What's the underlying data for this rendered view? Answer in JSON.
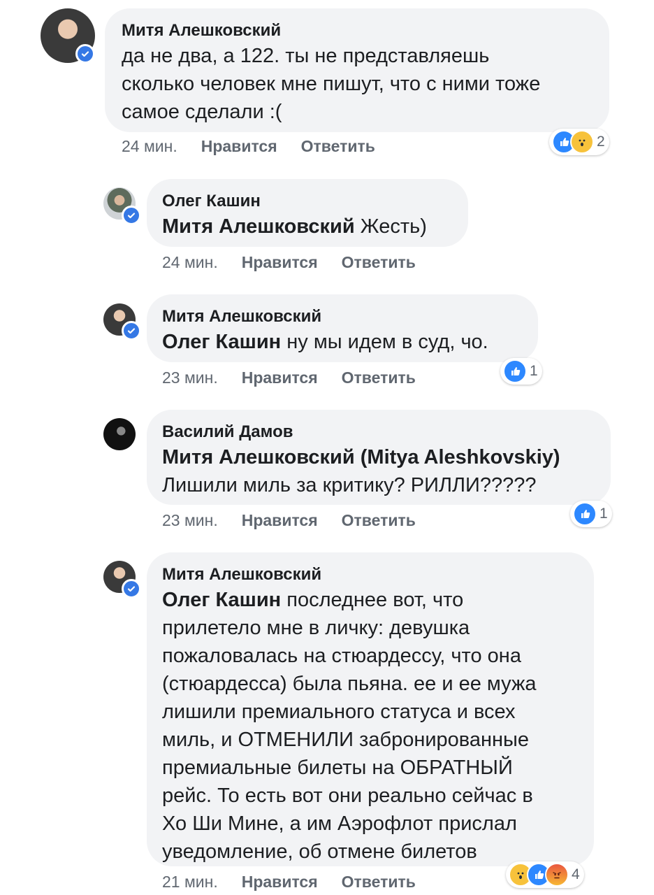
{
  "comments": [
    {
      "author": "Митя Алешковский",
      "mention": "",
      "lines": [
        "да не два, а 122. ты не представляешь",
        "сколько человек мне пишут, что с ними тоже",
        "самое сделали :("
      ],
      "time": "24 мин.",
      "like_label": "Нравится",
      "reply_label": "Ответить",
      "reactions": [
        "like",
        "wow"
      ],
      "reaction_count": "2"
    },
    {
      "author": "Олег Кашин",
      "mention": "Митя Алешковский",
      "lines": [
        "Жесть)"
      ],
      "time": "24 мин.",
      "like_label": "Нравится",
      "reply_label": "Ответить",
      "reactions": [],
      "reaction_count": ""
    },
    {
      "author": "Митя Алешковский",
      "mention": "Олег Кашин",
      "lines": [
        "ну мы идем в суд, чо."
      ],
      "time": "23 мин.",
      "like_label": "Нравится",
      "reply_label": "Ответить",
      "reactions": [
        "like"
      ],
      "reaction_count": "1"
    },
    {
      "author": "Василий Дамов",
      "mention": "Митя Алешковский (Mitya Aleshkovskiy)",
      "lines": [
        "Лишили миль за критику? РИЛЛИ?????"
      ],
      "time": "23 мин.",
      "like_label": "Нравится",
      "reply_label": "Ответить",
      "reactions": [
        "like"
      ],
      "reaction_count": "1"
    },
    {
      "author": "Митя Алешковский",
      "mention": "Олег Кашин",
      "lines": [
        "последнее вот, что",
        "прилетело мне в личку: девушка",
        "пожаловалась на стюардессу, что она",
        "(стюардесса) была пьяна. ее и ее мужа",
        "лишили премиального статуса и всех",
        "миль, и ОТМЕНИЛИ забронированные",
        "премиальные билеты на ОБРАТНЫЙ",
        "рейс. То есть вот они реально сейчас в",
        "Хо Ши Мине, а им Аэрофлот прислал",
        "уведомление, об отмене билетов"
      ],
      "time": "21 мин.",
      "like_label": "Нравится",
      "reply_label": "Ответить",
      "reactions": [
        "wow",
        "like",
        "angry"
      ],
      "reaction_count": "4"
    }
  ],
  "colors": {
    "bubble": "#f2f3f5",
    "like": "#2d88ff",
    "verified": "#3578e5",
    "meta": "#606770"
  }
}
